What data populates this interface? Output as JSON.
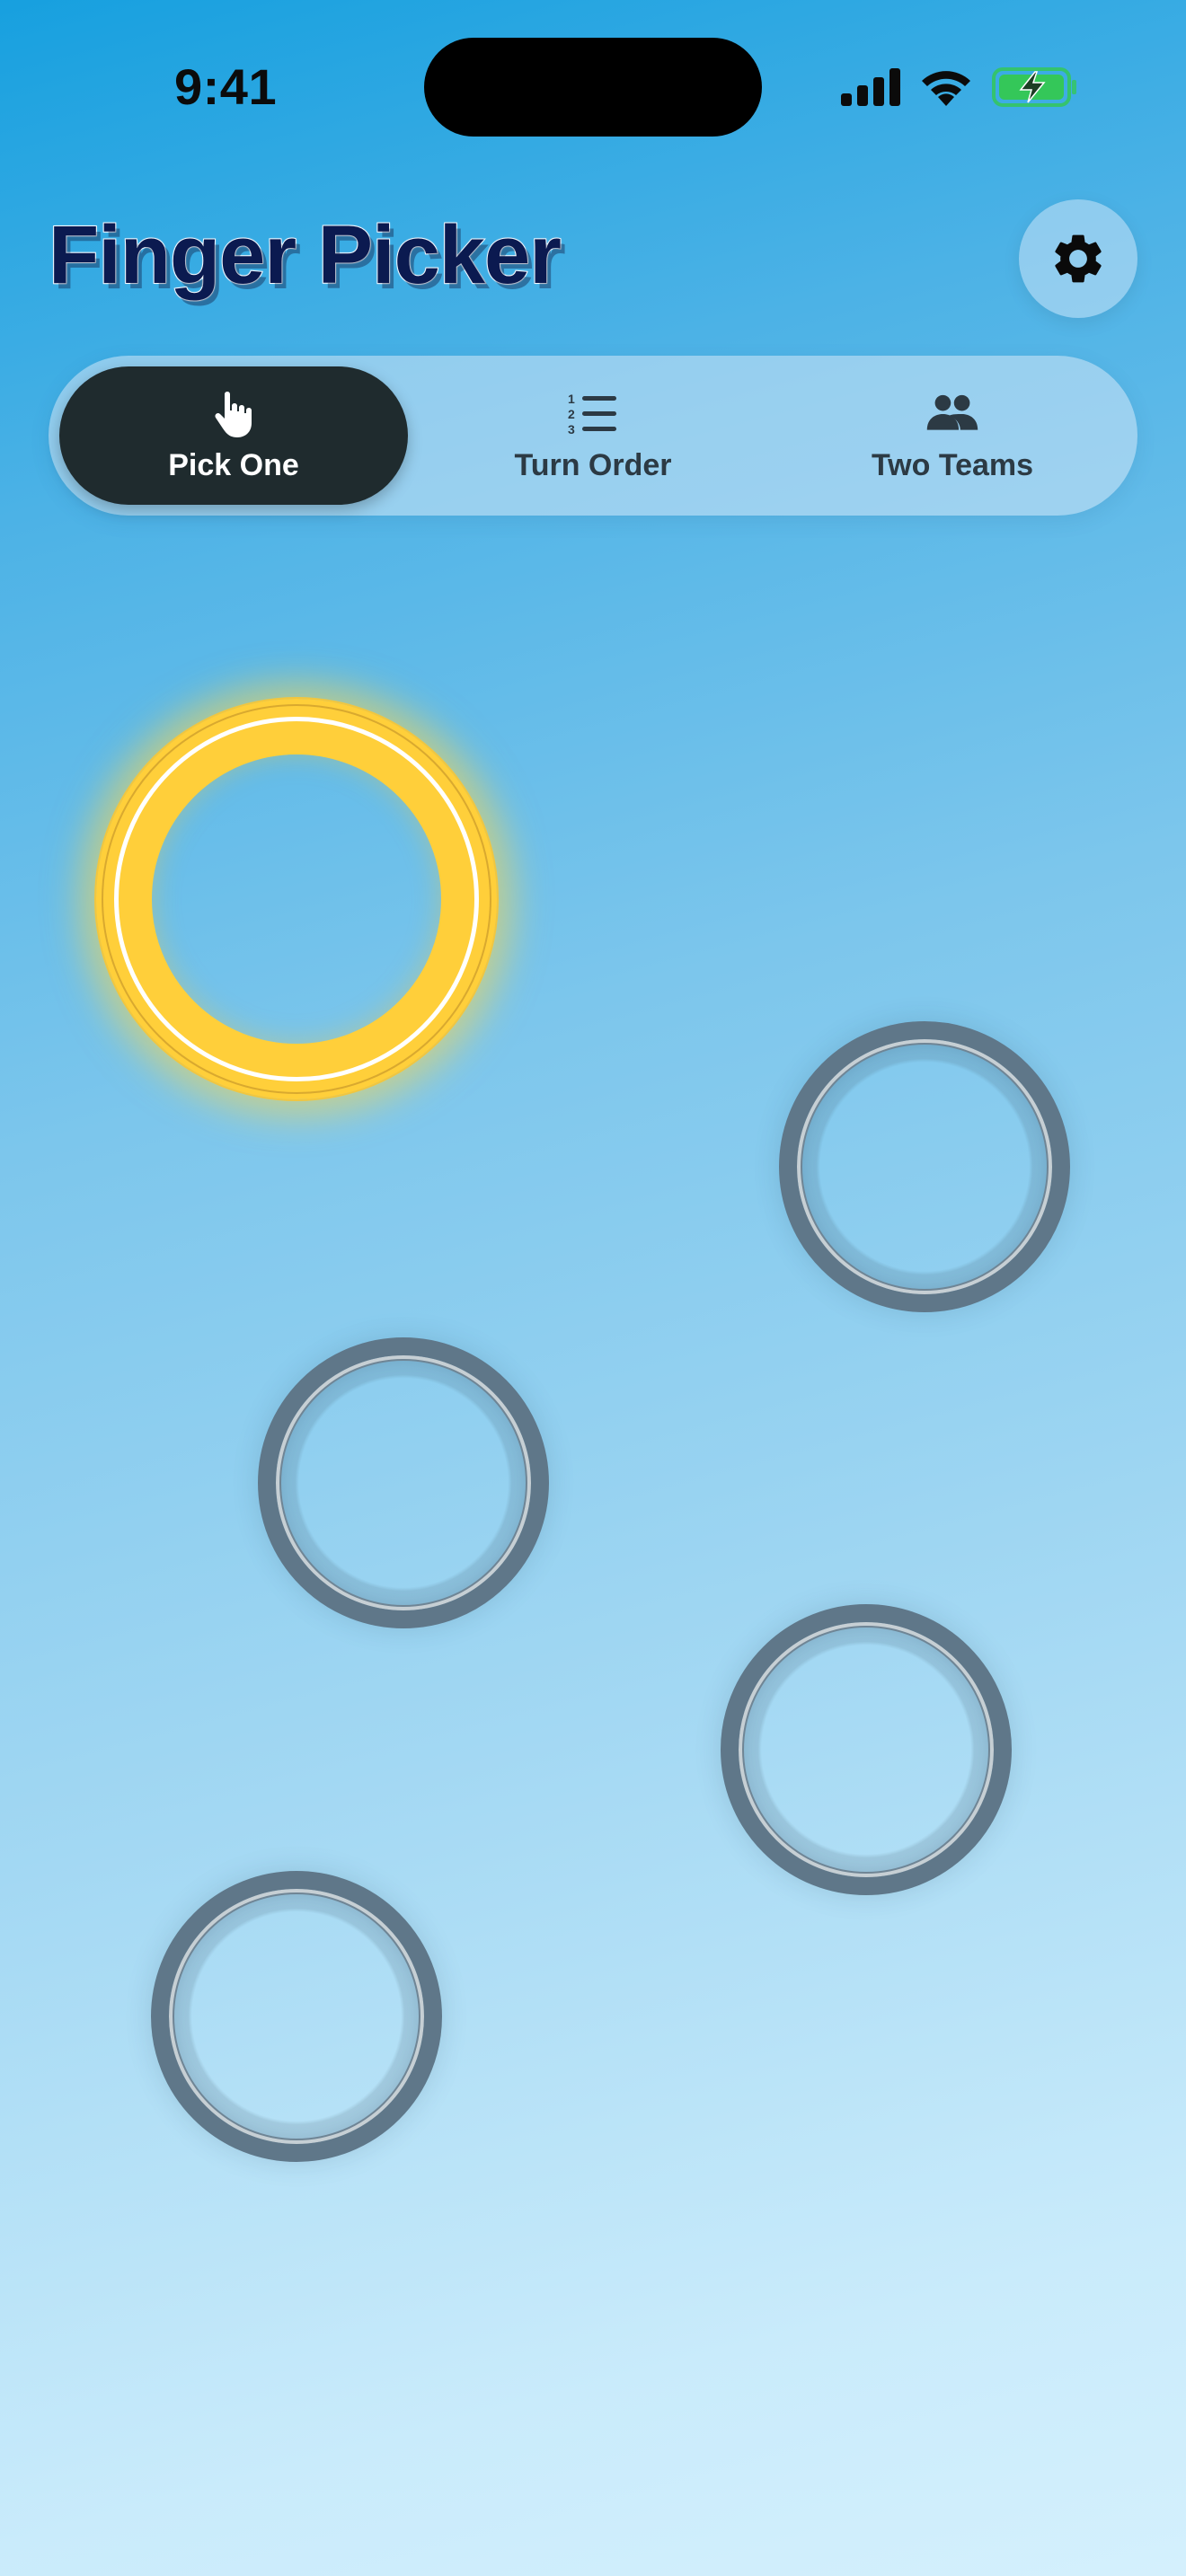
{
  "status_bar": {
    "time": "9:41",
    "icons": [
      "signal-bars-icon",
      "wifi-icon",
      "battery-charging-icon"
    ],
    "battery_color": "#34c759"
  },
  "header": {
    "title": "Finger Picker",
    "settings_icon": "gear-icon"
  },
  "mode_selector": {
    "modes": [
      {
        "label": "Pick One",
        "icon": "hand-pointer-icon",
        "selected": true
      },
      {
        "label": "Turn Order",
        "icon": "numbered-list-icon",
        "selected": false
      },
      {
        "label": "Two Teams",
        "icon": "people-icon",
        "selected": false
      }
    ]
  },
  "colors": {
    "winner": "#ffcf3a",
    "idle_ring": "#5f7789",
    "active_segment": "#1f2b2e",
    "title": "#0b1a50"
  },
  "fingers": [
    {
      "state": "winner"
    },
    {
      "state": "idle"
    },
    {
      "state": "idle"
    },
    {
      "state": "idle"
    },
    {
      "state": "idle"
    }
  ]
}
